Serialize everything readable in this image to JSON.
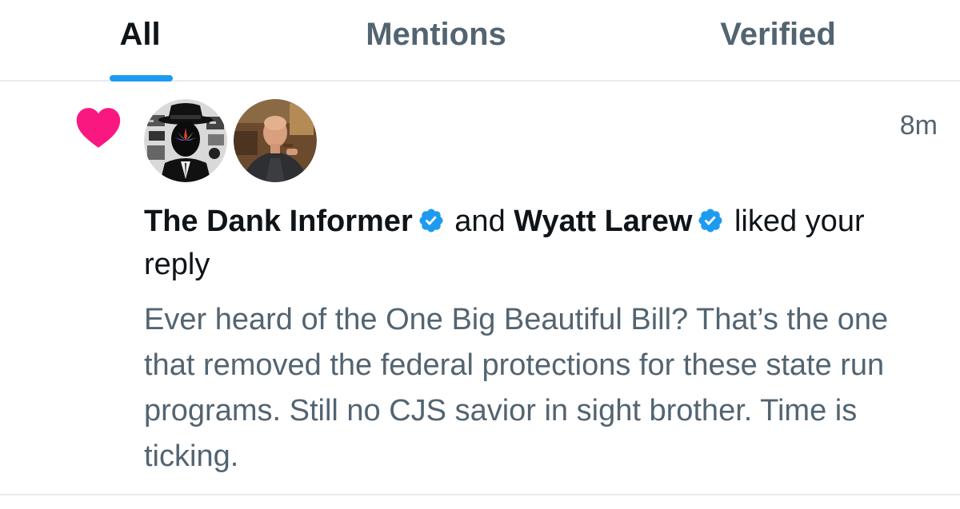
{
  "tabs": [
    {
      "label": "All",
      "active": true
    },
    {
      "label": "Mentions",
      "active": false
    },
    {
      "label": "Verified",
      "active": false
    }
  ],
  "notification": {
    "icon": "heart-icon",
    "icon_color": "#f91880",
    "timestamp": "8m",
    "user1": "The Dank Informer",
    "connector": "and",
    "user2": "Wyatt Larew",
    "action": "liked your reply",
    "reply_text": "Ever heard of the One Big Beautiful Bill? That’s the one that removed the federal protections for these state run programs. Still no CJS savior in sight brother. Time is ticking."
  },
  "colors": {
    "accent": "#1d9bf0",
    "secondary_text": "#536471",
    "primary_text": "#0f1419",
    "divider": "#e7ecf0"
  }
}
